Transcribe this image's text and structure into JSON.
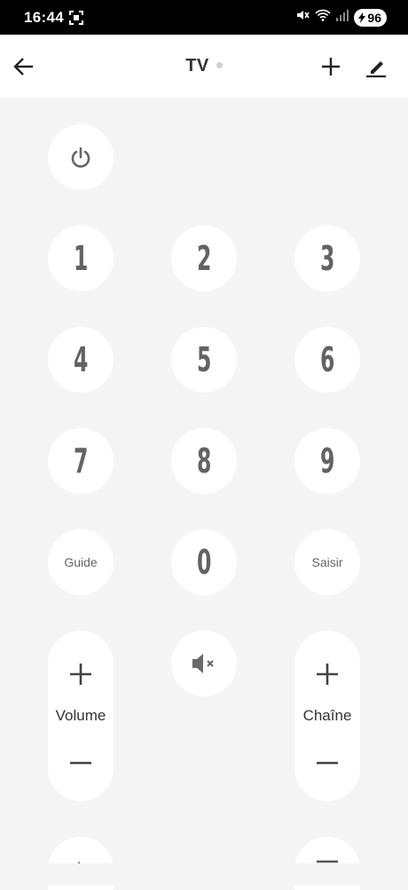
{
  "status_bar": {
    "time": "16:44",
    "battery": "96"
  },
  "header": {
    "title": "TV"
  },
  "buttons": {
    "digits": [
      "1",
      "2",
      "3",
      "4",
      "5",
      "6",
      "7",
      "8",
      "9",
      "0"
    ],
    "guide": "Guide",
    "enter": "Saisir"
  },
  "volume": {
    "label": "Volume"
  },
  "channel": {
    "label": "Chaîne"
  }
}
